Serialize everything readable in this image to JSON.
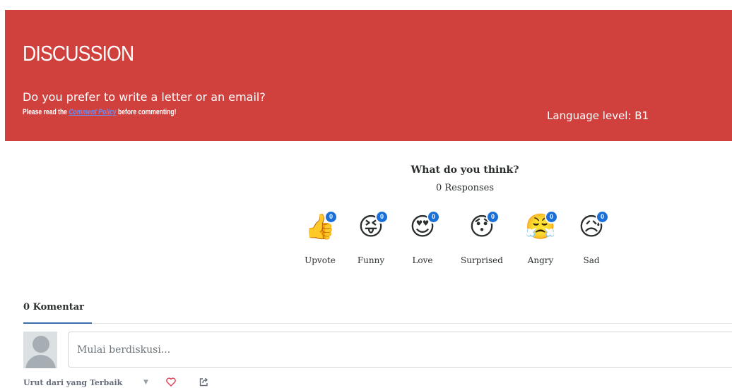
{
  "banner": {
    "title": "DISCUSSION",
    "question": "Do you prefer to write a letter or an email?",
    "policy_prefix": "Please read the ",
    "policy_link": "Comment Policy",
    "policy_suffix": " before commenting!",
    "language_level": "Language level: B1",
    "background_color": "#d0413e"
  },
  "reactions": {
    "heading": "What do you think?",
    "responses": "0 Responses",
    "items": [
      {
        "label": "Upvote",
        "icon": "thumbs-up-icon",
        "glyph": "👍",
        "count": "0"
      },
      {
        "label": "Funny",
        "icon": "funny-icon",
        "glyph": "😝",
        "count": "0"
      },
      {
        "label": "Love",
        "icon": "love-icon",
        "glyph": "😍",
        "count": "0"
      },
      {
        "label": "Surprised",
        "icon": "surprised-icon",
        "glyph": "😯",
        "count": "0"
      },
      {
        "label": "Angry",
        "icon": "angry-icon",
        "glyph": "😤",
        "count": "0"
      },
      {
        "label": "Sad",
        "icon": "sad-icon",
        "glyph": "😥",
        "count": "0"
      }
    ],
    "badge_color": "#1c6fd6"
  },
  "comments": {
    "count_label": "0 Komentar",
    "input_placeholder": "Mulai berdiskusi...",
    "sort_label": "Urut dari yang Terbaik",
    "accent_color": "#3a6fb0"
  }
}
